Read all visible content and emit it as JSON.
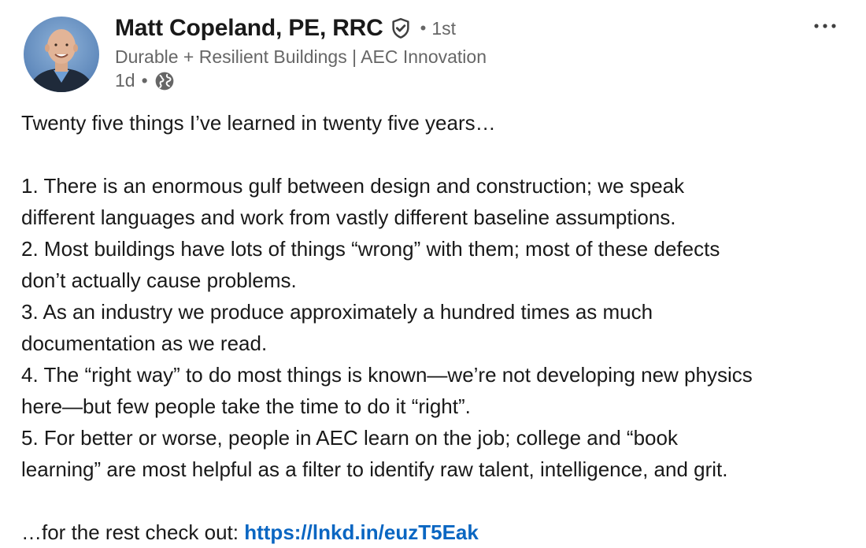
{
  "author": {
    "name": "Matt Copeland, PE, RRC",
    "verified_icon": "shield-check-icon",
    "degree_separator": "•",
    "degree": "1st",
    "headline": "Durable + Resilient Buildings | AEC Innovation",
    "time": "1d",
    "time_separator": "•",
    "visibility_icon": "globe-icon"
  },
  "menu": {
    "more_label": "…",
    "icon": "more-horizontal-icon"
  },
  "post": {
    "intro": "Twenty five things I’ve learned in twenty five years…",
    "lines": [
      "1. There is an enormous gulf between design and construction; we speak",
      "different languages and work from vastly different baseline assumptions.",
      "2. Most buildings have lots of things “wrong” with them; most of these defects",
      "don’t actually cause problems.",
      "3. As an industry we produce approximately a hundred times as much",
      "documentation as we read.",
      "4. The “right way” to do most things is known—we’re not developing new physics",
      "here—but few people take the time to do it “right”.",
      "5. For better or worse, people in AEC learn on the job; college and “book",
      "learning” are most helpful as a filter to identify raw talent, intelligence, and grit."
    ],
    "outro_prefix": "…for the rest check out: ",
    "link_text": "https://lnkd.in/euzT5Eak"
  },
  "colors": {
    "text": "#191919",
    "secondary": "#666666",
    "link": "#0a66c2"
  }
}
